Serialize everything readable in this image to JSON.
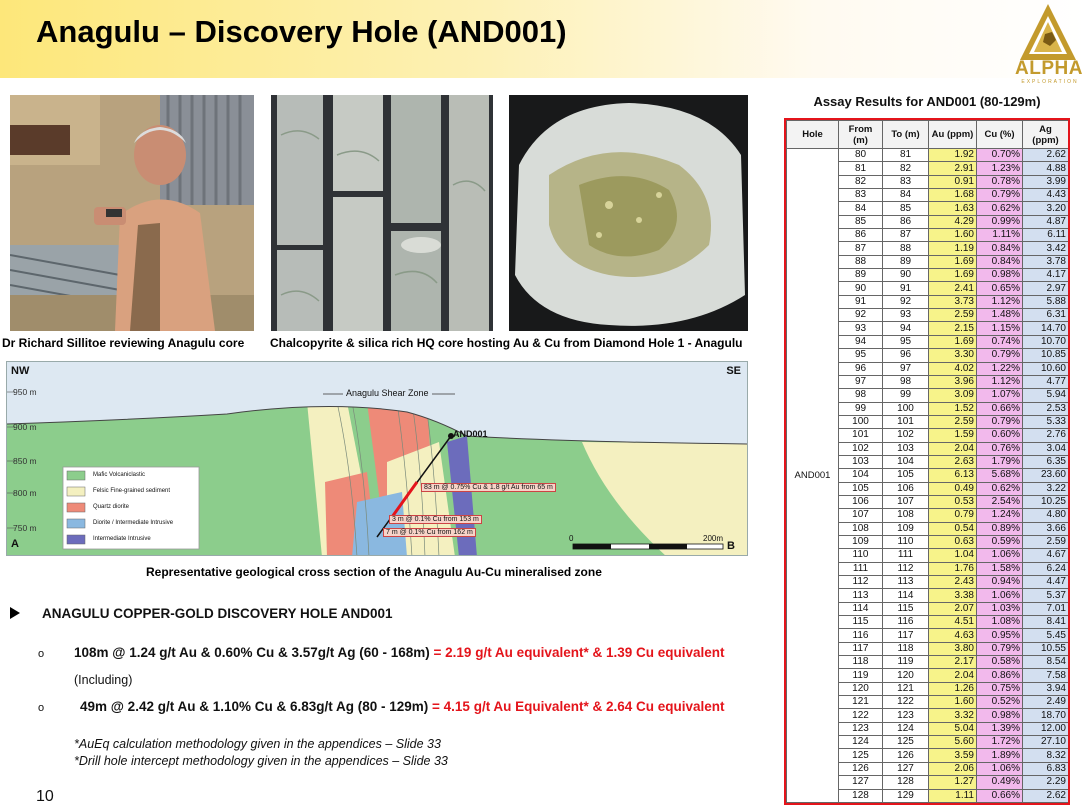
{
  "slide": {
    "title": "Anagulu – Discovery Hole (AND001)",
    "logo_text": "ALPHA",
    "logo_subtext": "EXPLORATION",
    "page_number": "10"
  },
  "photos": {
    "caption_1": "Dr Richard Sillitoe reviewing Anagulu core",
    "caption_2": "Chalcopyrite & silica rich HQ core hosting Au & Cu from Diamond Hole 1 - Anagulu"
  },
  "cross_section": {
    "nw_label": "NW",
    "se_label": "SE",
    "shear_zone_label": "Anagulu Shear Zone",
    "elevations": [
      "950 m",
      "900 m",
      "850 m",
      "800 m",
      "750 m"
    ],
    "hole_label": "AND001",
    "intercept_1": "83 m @ 0.75% Cu & 1.8 g/t Au from 65 m",
    "intercept_2": "3 m @ 0.1% Cu from 153 m",
    "intercept_3": "7 m @ 0.1% Cu from 162 m",
    "legend": [
      {
        "label": "Mafic Volcaniclastic",
        "color": "#8ccd8c"
      },
      {
        "label": "Felsic Fine-grained sediment",
        "color": "#f4f0c0"
      },
      {
        "label": "Quartz diorite",
        "color": "#ee8a78"
      },
      {
        "label": "Diorite / Intermediate Intrusive",
        "color": "#8ab8e0"
      },
      {
        "label": "Intermediate Intrusive",
        "color": "#6c6cbc"
      }
    ],
    "scale_start": "0",
    "scale_end": "200m",
    "corner_a": "A",
    "corner_b": "B",
    "caption": "Representative geological cross section of the Anagulu Au-Cu mineralised zone"
  },
  "bullets": {
    "heading": "ANAGULU COPPER-GOLD DISCOVERY HOLE AND001",
    "result_1_black": "108m @ 1.24 g/t Au & 0.60% Cu & 3.57g/t Ag (60 - 168m)",
    "result_1_red": " = 2.19 g/t Au equivalent* & 1.39 Cu equivalent",
    "including": "(Including)",
    "result_2_black": "49m @ 2.42 g/t Au & 1.10% Cu & 6.83g/t Ag (80 - 129m)",
    "result_2_red": " = 4.15 g/t Au Equivalent* & 2.64 Cu equivalent",
    "note_1": "*AuEq calculation methodology given in the appendices – Slide 33",
    "note_2": "*Drill hole intercept methodology given in the appendices – Slide 33",
    "circle_marker": "o"
  },
  "assay": {
    "title": "Assay Results for AND001 (80-129m)",
    "headers": [
      "Hole",
      "From (m)",
      "To (m)",
      "Au (ppm)",
      "Cu (%)",
      "Ag (ppm)"
    ],
    "hole_id": "AND001",
    "colors": {
      "au": "#f7f38a",
      "cu": "#f2b9ec",
      "ag": "#d3dff0"
    },
    "rows": [
      [
        "80",
        "81",
        "1.92",
        "0.70%",
        "2.62"
      ],
      [
        "81",
        "82",
        "2.91",
        "1.23%",
        "4.88"
      ],
      [
        "82",
        "83",
        "0.91",
        "0.78%",
        "3.99"
      ],
      [
        "83",
        "84",
        "1.68",
        "0.79%",
        "4.43"
      ],
      [
        "84",
        "85",
        "1.63",
        "0.62%",
        "3.20"
      ],
      [
        "85",
        "86",
        "4.29",
        "0.99%",
        "4.87"
      ],
      [
        "86",
        "87",
        "1.60",
        "1.11%",
        "6.11"
      ],
      [
        "87",
        "88",
        "1.19",
        "0.84%",
        "3.42"
      ],
      [
        "88",
        "89",
        "1.69",
        "0.84%",
        "3.78"
      ],
      [
        "89",
        "90",
        "1.69",
        "0.98%",
        "4.17"
      ],
      [
        "90",
        "91",
        "2.41",
        "0.65%",
        "2.97"
      ],
      [
        "91",
        "92",
        "3.73",
        "1.12%",
        "5.88"
      ],
      [
        "92",
        "93",
        "2.59",
        "1.48%",
        "6.31"
      ],
      [
        "93",
        "94",
        "2.15",
        "1.15%",
        "14.70"
      ],
      [
        "94",
        "95",
        "1.69",
        "0.74%",
        "10.70"
      ],
      [
        "95",
        "96",
        "3.30",
        "0.79%",
        "10.85"
      ],
      [
        "96",
        "97",
        "4.02",
        "1.22%",
        "10.60"
      ],
      [
        "97",
        "98",
        "3.96",
        "1.12%",
        "4.77"
      ],
      [
        "98",
        "99",
        "3.09",
        "1.07%",
        "5.94"
      ],
      [
        "99",
        "100",
        "1.52",
        "0.66%",
        "2.53"
      ],
      [
        "100",
        "101",
        "2.59",
        "0.79%",
        "5.33"
      ],
      [
        "101",
        "102",
        "1.59",
        "0.60%",
        "2.76"
      ],
      [
        "102",
        "103",
        "2.04",
        "0.76%",
        "3.04"
      ],
      [
        "103",
        "104",
        "2.63",
        "1.79%",
        "6.35"
      ],
      [
        "104",
        "105",
        "6.13",
        "5.68%",
        "23.60"
      ],
      [
        "105",
        "106",
        "0.49",
        "0.62%",
        "3.22"
      ],
      [
        "106",
        "107",
        "0.53",
        "2.54%",
        "10.25"
      ],
      [
        "107",
        "108",
        "0.79",
        "1.24%",
        "4.80"
      ],
      [
        "108",
        "109",
        "0.54",
        "0.89%",
        "3.66"
      ],
      [
        "109",
        "110",
        "0.63",
        "0.59%",
        "2.59"
      ],
      [
        "110",
        "111",
        "1.04",
        "1.06%",
        "4.67"
      ],
      [
        "111",
        "112",
        "1.76",
        "1.58%",
        "6.24"
      ],
      [
        "112",
        "113",
        "2.43",
        "0.94%",
        "4.47"
      ],
      [
        "113",
        "114",
        "3.38",
        "1.06%",
        "5.37"
      ],
      [
        "114",
        "115",
        "2.07",
        "1.03%",
        "7.01"
      ],
      [
        "115",
        "116",
        "4.51",
        "1.08%",
        "8.41"
      ],
      [
        "116",
        "117",
        "4.63",
        "0.95%",
        "5.45"
      ],
      [
        "117",
        "118",
        "3.80",
        "0.79%",
        "10.55"
      ],
      [
        "118",
        "119",
        "2.17",
        "0.58%",
        "8.54"
      ],
      [
        "119",
        "120",
        "2.04",
        "0.86%",
        "7.58"
      ],
      [
        "120",
        "121",
        "1.26",
        "0.75%",
        "3.94"
      ],
      [
        "121",
        "122",
        "1.60",
        "0.52%",
        "2.49"
      ],
      [
        "122",
        "123",
        "3.32",
        "0.98%",
        "18.70"
      ],
      [
        "123",
        "124",
        "5.04",
        "1.39%",
        "12.00"
      ],
      [
        "124",
        "125",
        "5.60",
        "1.72%",
        "27.10"
      ],
      [
        "125",
        "126",
        "3.59",
        "1.89%",
        "8.32"
      ],
      [
        "126",
        "127",
        "2.06",
        "1.06%",
        "6.83"
      ],
      [
        "127",
        "128",
        "1.27",
        "0.49%",
        "2.29"
      ],
      [
        "128",
        "129",
        "1.11",
        "0.66%",
        "2.62"
      ]
    ]
  }
}
